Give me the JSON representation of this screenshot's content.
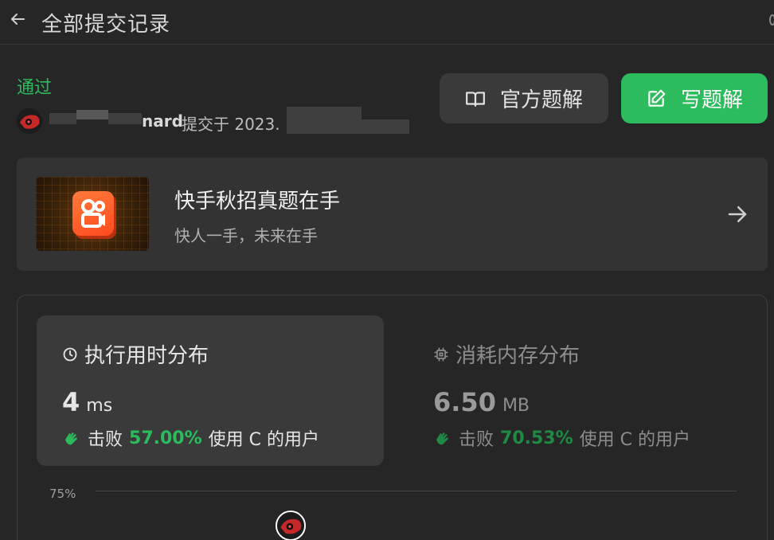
{
  "header": {
    "title": "全部提交记录"
  },
  "submission": {
    "status": "通过",
    "username_visible": "nard",
    "submitted_text": "提交于 2023."
  },
  "buttons": {
    "official_solution": "官方题解",
    "write_solution": "写题解"
  },
  "banner": {
    "title": "快手秋招真题在手",
    "subtitle": "快人一手，未来在手"
  },
  "runtime": {
    "heading": "执行用时分布",
    "value": "4",
    "unit": "ms",
    "beats_label": "击败",
    "percent": "57.00%",
    "suffix": "使用 C 的用户"
  },
  "memory": {
    "heading": "消耗内存分布",
    "value": "6.50",
    "unit": "MB",
    "beats_label": "击败",
    "percent": "70.53%",
    "suffix": "使用 C 的用户"
  },
  "chart": {
    "y_tick": "75%"
  },
  "colors": {
    "accent_green": "#2cbb5d",
    "background": "#262626",
    "panel": "#3a3a3a"
  }
}
